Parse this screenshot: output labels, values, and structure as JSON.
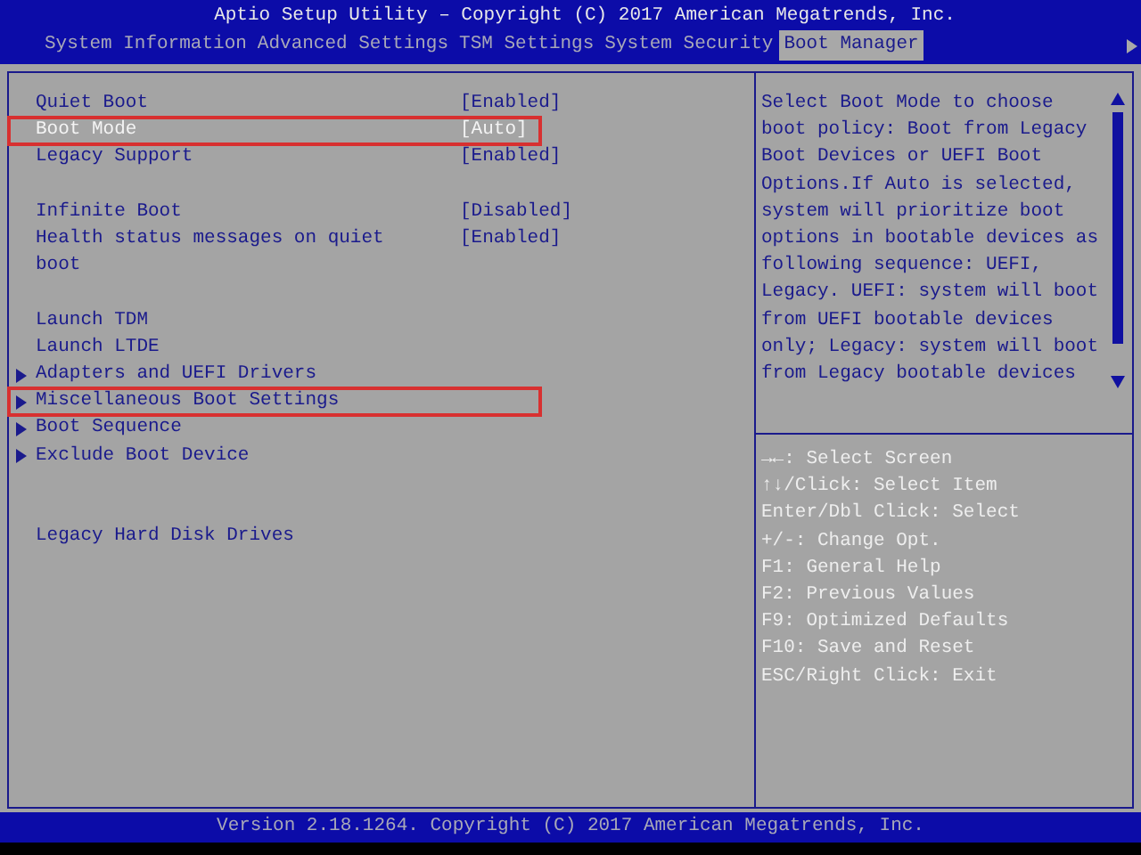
{
  "window": {
    "title": "Aptio Setup Utility – Copyright (C) 2017 American Megatrends, Inc."
  },
  "tabs": [
    {
      "label": "System Information",
      "selected": false
    },
    {
      "label": "Advanced Settings",
      "selected": false
    },
    {
      "label": "TSM Settings",
      "selected": false
    },
    {
      "label": "System Security",
      "selected": false
    },
    {
      "label": "Boot Manager",
      "selected": true
    }
  ],
  "settings": {
    "groups": [
      {
        "items": [
          {
            "kind": "option",
            "label": "Quiet Boot",
            "value": "[Enabled]",
            "selected": false,
            "highlighted": false
          },
          {
            "kind": "option",
            "label": "Boot Mode",
            "value": "[Auto]",
            "selected": true,
            "highlighted": true
          },
          {
            "kind": "option",
            "label": "Legacy Support",
            "value": "[Enabled]",
            "selected": false,
            "highlighted": false
          }
        ]
      },
      {
        "items": [
          {
            "kind": "option",
            "label": "Infinite Boot",
            "value": "[Disabled]",
            "selected": false,
            "highlighted": false
          },
          {
            "kind": "option",
            "label": "Health status messages on quiet boot",
            "value": "[Enabled]",
            "selected": false,
            "highlighted": false
          }
        ]
      },
      {
        "items": [
          {
            "kind": "action",
            "label": "Launch TDM",
            "selected": false,
            "highlighted": false
          },
          {
            "kind": "action",
            "label": "Launch LTDE",
            "selected": false,
            "highlighted": false
          },
          {
            "kind": "submenu",
            "label": "Adapters and UEFI Drivers",
            "selected": false,
            "highlighted": false
          },
          {
            "kind": "submenu",
            "label": "Miscellaneous Boot Settings",
            "selected": false,
            "highlighted": true
          },
          {
            "kind": "submenu",
            "label": "Boot Sequence",
            "selected": false,
            "highlighted": false
          },
          {
            "kind": "submenu",
            "label": "Exclude Boot Device",
            "selected": false,
            "highlighted": false
          }
        ]
      },
      {
        "items": [
          {
            "kind": "action",
            "label": "Legacy Hard Disk Drives",
            "selected": false,
            "highlighted": false
          }
        ]
      }
    ]
  },
  "help": {
    "text": "Select Boot Mode to choose boot policy: Boot from Legacy Boot Devices or UEFI Boot Options.If Auto is selected, system will prioritize boot options in bootable devices as following sequence: UEFI, Legacy. UEFI: system will boot from UEFI bootable devices only; Legacy: system will boot from Legacy bootable devices"
  },
  "keys": [
    "→←: Select Screen",
    "↑↓/Click: Select Item",
    "Enter/Dbl Click: Select",
    "+/-: Change Opt.",
    "F1: General Help",
    "F2: Previous Values",
    "F9: Optimized Defaults",
    "F10: Save and Reset",
    "ESC/Right Click: Exit"
  ],
  "status_bar": {
    "text": "Version 2.18.1264. Copyright (C) 2017 American Megatrends, Inc."
  }
}
